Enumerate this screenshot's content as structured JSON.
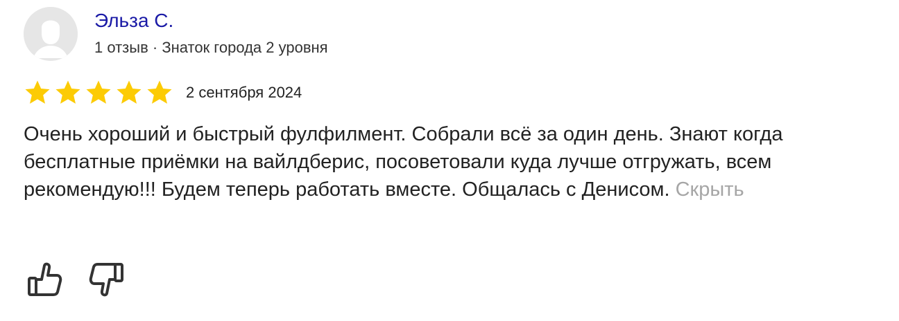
{
  "review": {
    "author": {
      "name": "Эльза С.",
      "meta": "1 отзыв · Знаток города 2 уровня",
      "avatar_icon": "user-silhouette-icon"
    },
    "rating": {
      "stars": 5,
      "max": 5,
      "star_color": "#fccb05"
    },
    "date": "2 сентября 2024",
    "text": "Очень хороший и быстрый фулфилмент. Собрали всё за один день. Знают когда бесплатные приёмки на вайлдберис, посоветовали куда лучше отгружать, всем рекомендую!!! Будем теперь работать вместе. Общалась с Денисом.",
    "hide_label": "Скрыть",
    "reactions": {
      "like_icon": "thumbs-up-icon",
      "dislike_icon": "thumbs-down-icon"
    }
  },
  "colors": {
    "author_link": "#1a1aa6",
    "muted_link": "#a6a6a6",
    "text": "#222222"
  }
}
